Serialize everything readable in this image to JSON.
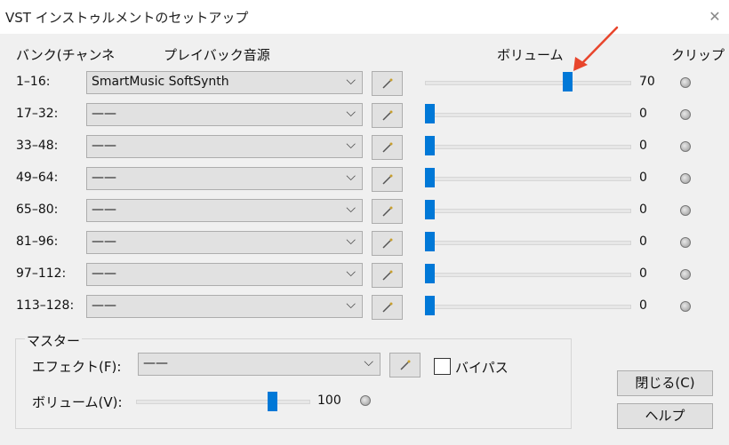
{
  "window": {
    "title": "VST インストゥルメントのセットアップ",
    "close_glyph": "✕"
  },
  "headers": {
    "bank": "バンク(チャンネ",
    "source": "プレイバック音源",
    "volume": "ボリューム",
    "clip": "クリップ"
  },
  "rows": [
    {
      "bank": "1–16:",
      "source": "SmartMusic SoftSynth",
      "volume": "70"
    },
    {
      "bank": "17–32:",
      "source": "——",
      "volume": "0"
    },
    {
      "bank": "33–48:",
      "source": "——",
      "volume": "0"
    },
    {
      "bank": "49–64:",
      "source": "——",
      "volume": "0"
    },
    {
      "bank": "65–80:",
      "source": "——",
      "volume": "0"
    },
    {
      "bank": "81–96:",
      "source": "——",
      "volume": "0"
    },
    {
      "bank": "97–112:",
      "source": "——",
      "volume": "0"
    },
    {
      "bank": "113–128:",
      "source": "——",
      "volume": "0"
    }
  ],
  "master": {
    "legend": "マスター",
    "effect_label": "エフェクト(F):",
    "effect_value": "——",
    "bypass_label": "バイパス",
    "bypass_checked": false,
    "volume_label": "ボリューム(V):",
    "volume_value": "100"
  },
  "buttons": {
    "close": "閉じる(C)",
    "help": "ヘルプ"
  },
  "icons": {
    "dropdown": "chevron-down-icon",
    "edit": "wand-icon",
    "clip": "clip-indicator-icon",
    "annotation": "red-arrow-icon"
  },
  "colors": {
    "accent": "#0078d7",
    "dialog_bg": "#f0f0f0",
    "annotation": "#e8452c"
  }
}
